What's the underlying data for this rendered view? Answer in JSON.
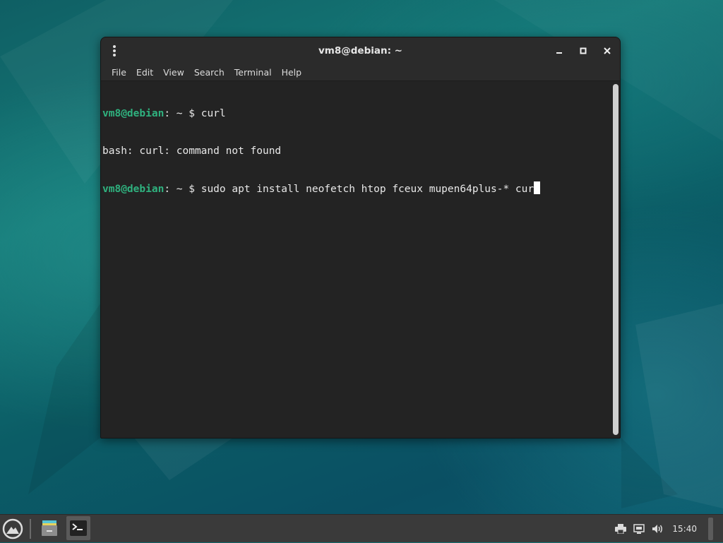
{
  "window": {
    "title": "vm8@debian: ~",
    "menu": [
      "File",
      "Edit",
      "View",
      "Search",
      "Terminal",
      "Help"
    ]
  },
  "terminal": {
    "lines": [
      {
        "user": "vm8@debian",
        "sep": ": ~",
        "cmd": "$ curl"
      },
      {
        "output": "bash: curl: command not found"
      },
      {
        "user": "vm8@debian",
        "sep": ": ~",
        "cmd": "$ sudo apt install neofetch htop fceux mupen64plus-* cur"
      }
    ]
  },
  "taskbar": {
    "clock": "15:40",
    "icons": [
      "menu-icon",
      "file-manager-icon",
      "terminal-icon",
      "printer-icon",
      "network-icon",
      "volume-icon"
    ]
  },
  "colors": {
    "prompt": "#2fb27f",
    "terminal_bg": "#232323",
    "titlebar_bg": "#2b2b2b",
    "taskbar_bg": "#3a3a3a"
  }
}
